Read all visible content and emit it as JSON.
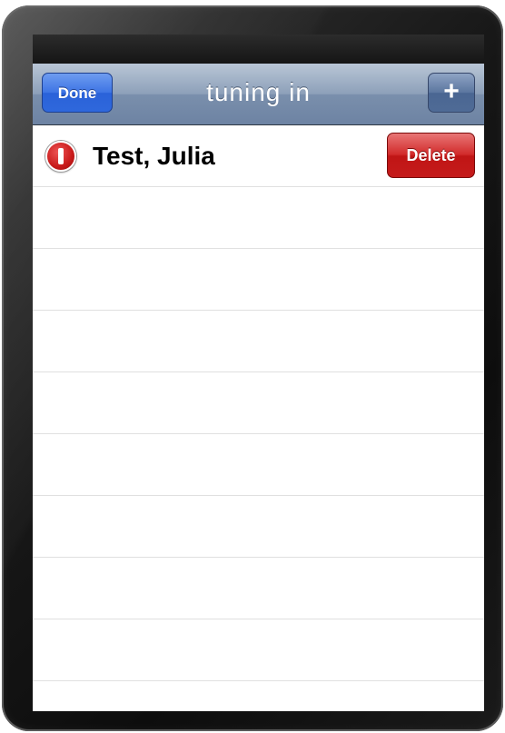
{
  "nav": {
    "title": "tuning in",
    "done_label": "Done",
    "add_label": "+"
  },
  "list": {
    "rows": [
      {
        "label": "Test, Julia",
        "delete_label": "Delete"
      }
    ],
    "empty_row_count": 8
  },
  "colors": {
    "nav_bar": "#8da0b9",
    "done_button": "#3d74e4",
    "delete_button": "#c01515",
    "separator": "#e0e0e0"
  }
}
